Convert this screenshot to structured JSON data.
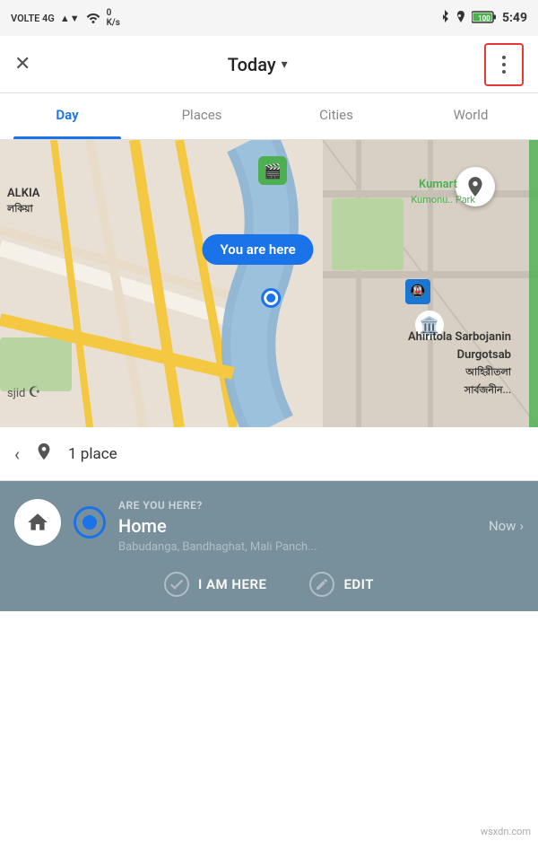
{
  "statusBar": {
    "carrier": "VOLTE 4G",
    "signal": "▲▼",
    "wifi": "WiFi",
    "battery": "100",
    "time": "5:49",
    "bluetooth": "bluetooth"
  },
  "header": {
    "title": "Today",
    "arrow": "▾",
    "close": "✕"
  },
  "tabs": [
    {
      "label": "Day",
      "active": true
    },
    {
      "label": "Places",
      "active": false
    },
    {
      "label": "Cities",
      "active": false
    },
    {
      "label": "World",
      "active": false
    }
  ],
  "map": {
    "youAreHere": "You are here",
    "labelAlkia": "ALKIA\nলকিয়া",
    "labelKumart": "Kumart",
    "labelKumont": "Kumonu.. Park",
    "labelAhiri": "Ahiritola Sarbojanin\nDurgotsab\nআহিরীতলা\nসার্বজনীন...",
    "labelSjid": "sjid"
  },
  "placesBar": {
    "count": "1 place",
    "backArrow": "‹"
  },
  "bottomPanel": {
    "question": "ARE YOU HERE?",
    "name": "Home",
    "time": "Now",
    "address": "Babudanga, Bandhaghat, Mali Panch...",
    "btnHere": "I AM HERE",
    "btnEdit": "EDIT"
  },
  "watermark": "wsxdn.com"
}
